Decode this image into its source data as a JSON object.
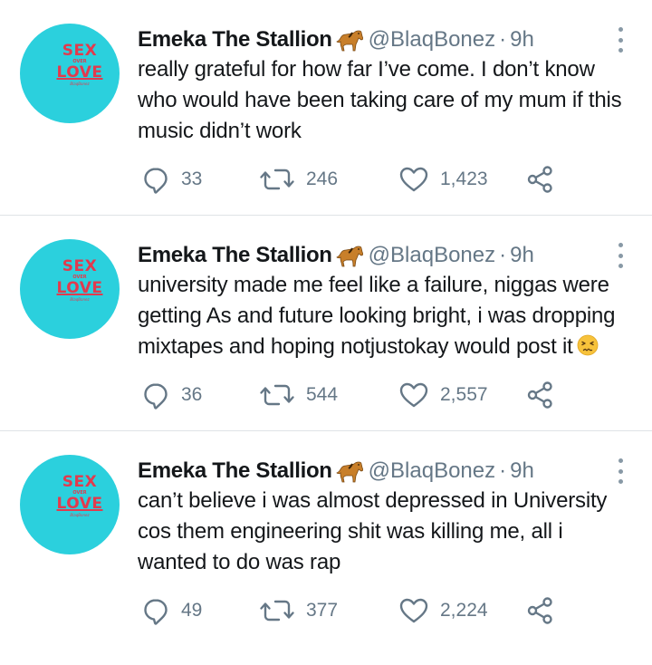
{
  "tweets": [
    {
      "name": "Emeka The Stallion",
      "handle": "@BlaqBonez",
      "dot": "·",
      "time": "9h",
      "text": "really grateful for how far I’ve come. I don’t know who would have been taking care of my mum if this music didn’t work",
      "has_emoji": false,
      "replies": "33",
      "retweets": "246",
      "likes": "1,423"
    },
    {
      "name": "Emeka The Stallion",
      "handle": "@BlaqBonez",
      "dot": "·",
      "time": "9h",
      "text": "university made me feel like a failure, niggas were getting As and future looking bright, i was dropping mixtapes and hoping notjustokay would post it",
      "has_emoji": true,
      "replies": "36",
      "retweets": "544",
      "likes": "2,557"
    },
    {
      "name": "Emeka The Stallion",
      "handle": "@BlaqBonez",
      "dot": "·",
      "time": "9h",
      "text": "can’t believe i was almost depressed in University cos them engineering shit was killing me, all i wanted to do was rap",
      "has_emoji": false,
      "replies": "49",
      "retweets": "377",
      "likes": "2,224"
    }
  ],
  "avatar_logo": {
    "line1": "SEX",
    "line2": "OVER",
    "line3": "LOVE",
    "line4": "BlaqBonez"
  },
  "colors": {
    "avatar_bg": "#2bd0dd",
    "logo": "#e23a4d",
    "secondary_text": "#657786",
    "divider": "#dfe3e6"
  },
  "icons": {
    "verified_emoji": "horse-icon",
    "reply": "reply-icon",
    "retweet": "retweet-icon",
    "like": "heart-icon",
    "share": "share-icon",
    "more": "more-vertical-icon",
    "emoji": "persevering-face-icon"
  }
}
